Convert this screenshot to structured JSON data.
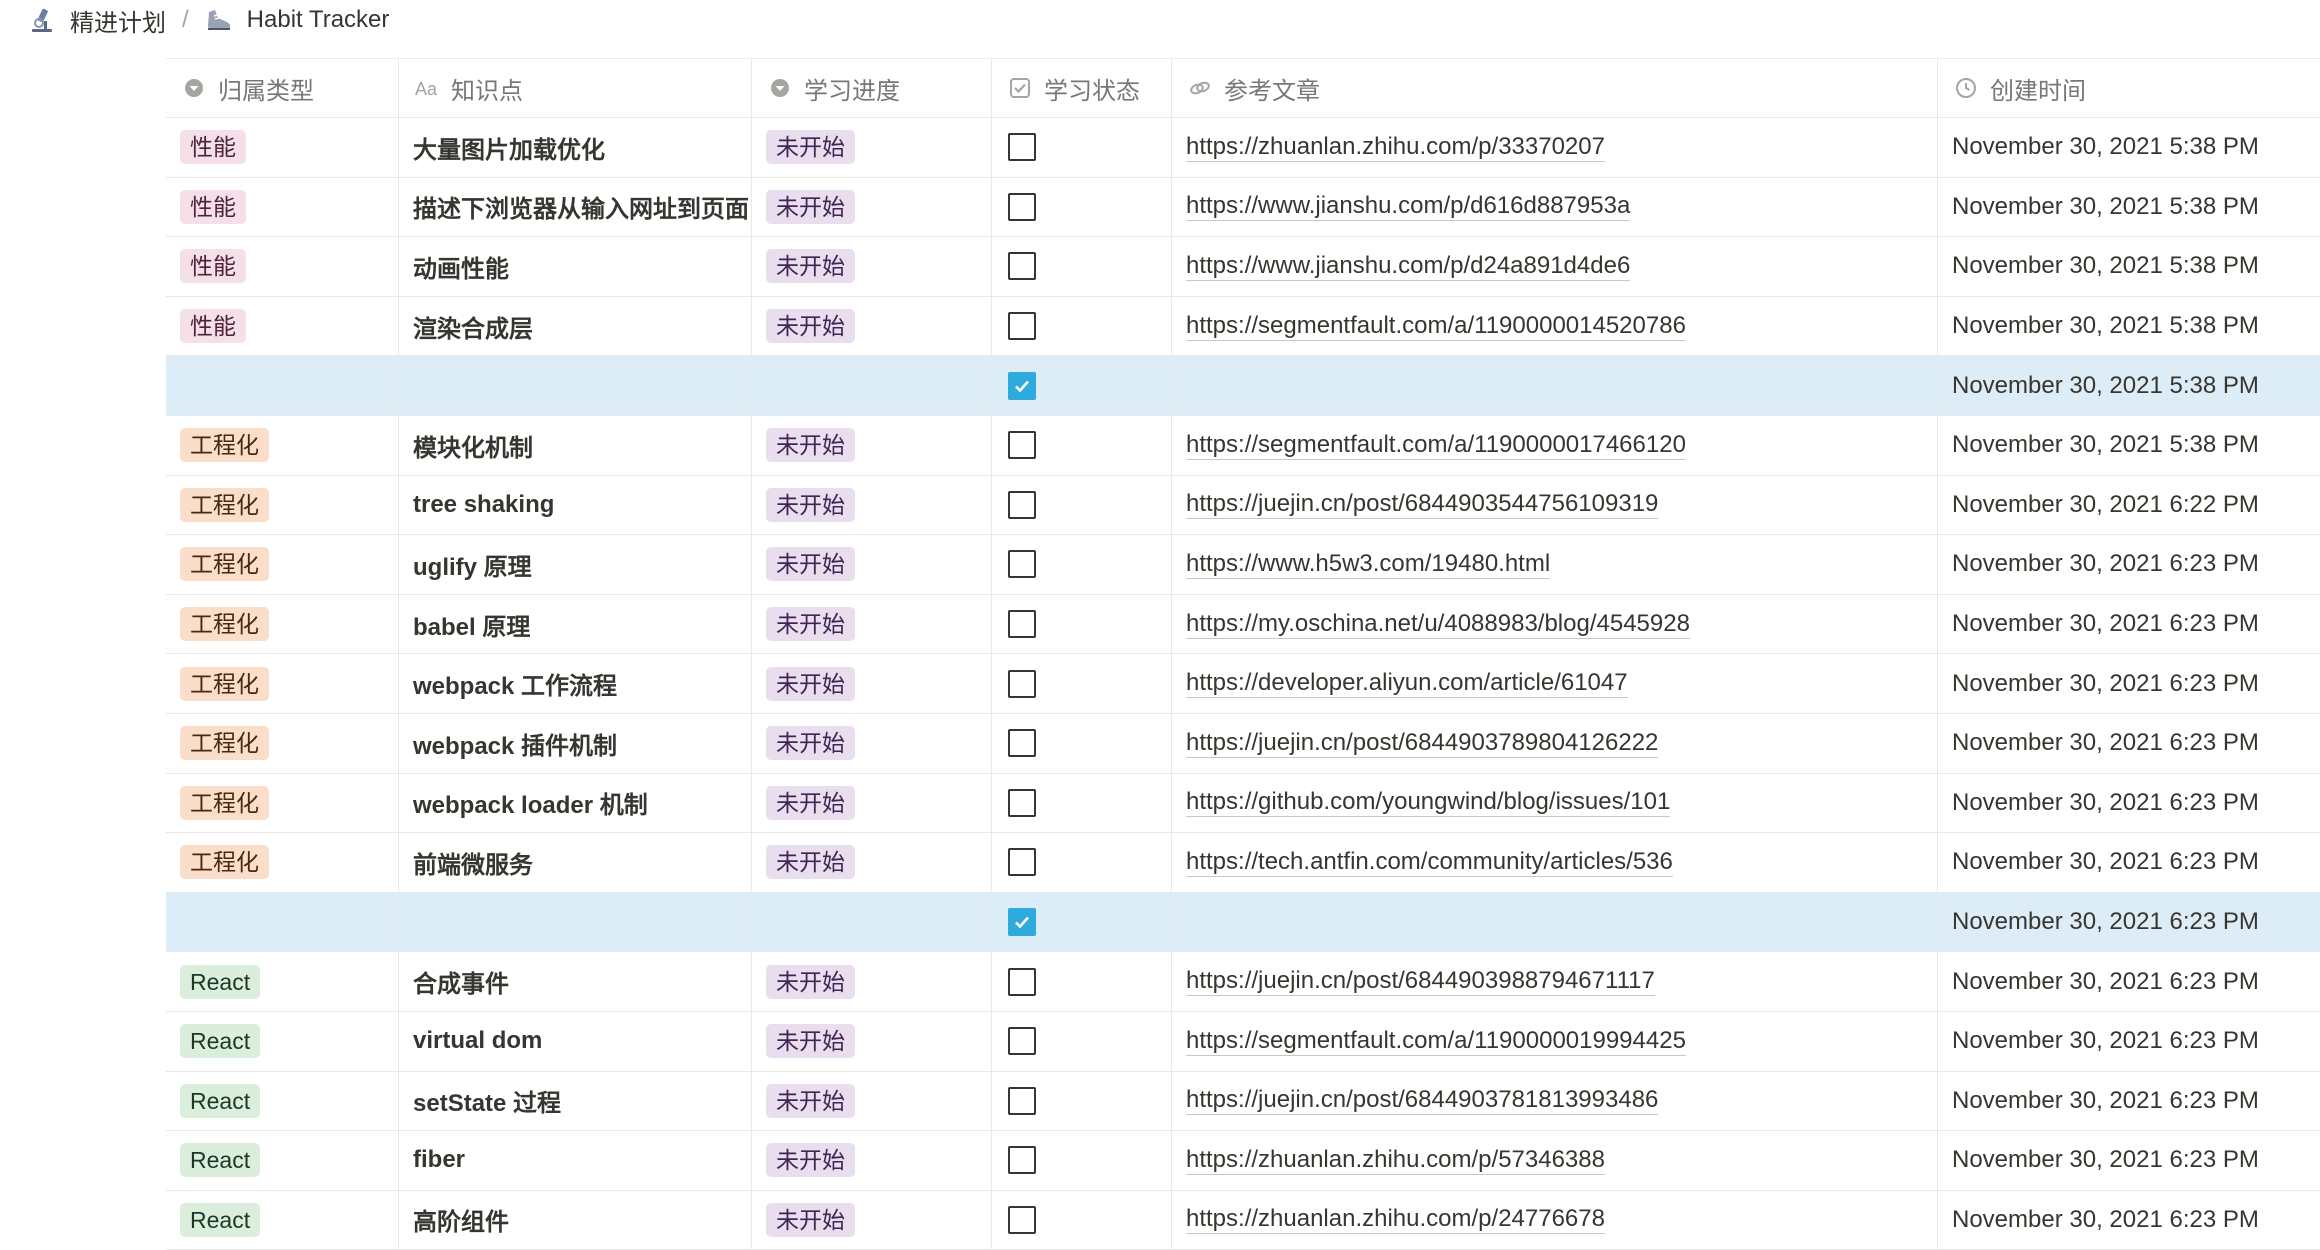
{
  "breadcrumb": {
    "items": [
      {
        "label": "精进计划",
        "icon": "microscope-icon"
      },
      {
        "label": "Habit Tracker",
        "icon": "running-shoe-icon"
      }
    ],
    "separator": "/"
  },
  "table": {
    "columns": [
      {
        "label": "归属类型",
        "icon": "select-icon"
      },
      {
        "label": "知识点",
        "icon": "title-aa-icon"
      },
      {
        "label": "学习进度",
        "icon": "select-icon"
      },
      {
        "label": "学习状态",
        "icon": "checkbox-icon"
      },
      {
        "label": "参考文章",
        "icon": "link-icon"
      },
      {
        "label": "创建时间",
        "icon": "clock-icon"
      }
    ],
    "tag_colors": {
      "性能": {
        "bg": "#f5e0e9",
        "fg": "#4c2337"
      },
      "工程化": {
        "bg": "#fadec9",
        "fg": "#49290e"
      },
      "React": {
        "bg": "#dbeddb",
        "fg": "#1c3829"
      },
      "未开始": {
        "bg": "#e8deee",
        "fg": "#412454"
      }
    },
    "rows": [
      {
        "type": "性能",
        "title": "大量图片加载优化",
        "progress": "未开始",
        "done": false,
        "url": "https://zhuanlan.zhihu.com/p/33370207",
        "created": "November 30, 2021 5:38 PM"
      },
      {
        "type": "性能",
        "title": "描述下浏览器从输入网址到页面",
        "progress": "未开始",
        "done": false,
        "url": "https://www.jianshu.com/p/d616d887953a",
        "created": "November 30, 2021 5:38 PM"
      },
      {
        "type": "性能",
        "title": "动画性能",
        "progress": "未开始",
        "done": false,
        "url": "https://www.jianshu.com/p/d24a891d4de6",
        "created": "November 30, 2021 5:38 PM"
      },
      {
        "type": "性能",
        "title": "渲染合成层",
        "progress": "未开始",
        "done": false,
        "url": "https://segmentfault.com/a/1190000014520786",
        "created": "November 30, 2021 5:38 PM"
      },
      {
        "type": "",
        "title": "",
        "progress": "",
        "done": true,
        "url": "",
        "created": "November 30, 2021 5:38 PM",
        "selected": true
      },
      {
        "type": "工程化",
        "title": "模块化机制",
        "progress": "未开始",
        "done": false,
        "url": "https://segmentfault.com/a/1190000017466120",
        "created": "November 30, 2021 5:38 PM"
      },
      {
        "type": "工程化",
        "title": "tree shaking",
        "progress": "未开始",
        "done": false,
        "url": "https://juejin.cn/post/6844903544756109319",
        "created": "November 30, 2021 6:22 PM"
      },
      {
        "type": "工程化",
        "title": "uglify 原理",
        "progress": "未开始",
        "done": false,
        "url": "https://www.h5w3.com/19480.html",
        "created": "November 30, 2021 6:23 PM"
      },
      {
        "type": "工程化",
        "title": "babel 原理",
        "progress": "未开始",
        "done": false,
        "url": "https://my.oschina.net/u/4088983/blog/4545928",
        "created": "November 30, 2021 6:23 PM"
      },
      {
        "type": "工程化",
        "title": "webpack 工作流程",
        "progress": "未开始",
        "done": false,
        "url": "https://developer.aliyun.com/article/61047",
        "created": "November 30, 2021 6:23 PM"
      },
      {
        "type": "工程化",
        "title": "webpack 插件机制",
        "progress": "未开始",
        "done": false,
        "url": "https://juejin.cn/post/6844903789804126222",
        "created": "November 30, 2021 6:23 PM"
      },
      {
        "type": "工程化",
        "title": "webpack loader 机制",
        "progress": "未开始",
        "done": false,
        "url": "https://github.com/youngwind/blog/issues/101",
        "created": "November 30, 2021 6:23 PM"
      },
      {
        "type": "工程化",
        "title": "前端微服务",
        "progress": "未开始",
        "done": false,
        "url": "https://tech.antfin.com/community/articles/536",
        "created": "November 30, 2021 6:23 PM"
      },
      {
        "type": "",
        "title": "",
        "progress": "",
        "done": true,
        "url": "",
        "created": "November 30, 2021 6:23 PM",
        "selected": true
      },
      {
        "type": "React",
        "title": "合成事件",
        "progress": "未开始",
        "done": false,
        "url": "https://juejin.cn/post/6844903988794671117",
        "created": "November 30, 2021 6:23 PM"
      },
      {
        "type": "React",
        "title": "virtual dom",
        "progress": "未开始",
        "done": false,
        "url": "https://segmentfault.com/a/1190000019994425",
        "created": "November 30, 2021 6:23 PM"
      },
      {
        "type": "React",
        "title": "setState 过程",
        "progress": "未开始",
        "done": false,
        "url": "https://juejin.cn/post/6844903781813993486",
        "created": "November 30, 2021 6:23 PM"
      },
      {
        "type": "React",
        "title": "fiber",
        "progress": "未开始",
        "done": false,
        "url": "https://zhuanlan.zhihu.com/p/57346388",
        "created": "November 30, 2021 6:23 PM"
      },
      {
        "type": "React",
        "title": "高阶组件",
        "progress": "未开始",
        "done": false,
        "url": "https://zhuanlan.zhihu.com/p/24776678",
        "created": "November 30, 2021 6:23 PM"
      }
    ]
  }
}
